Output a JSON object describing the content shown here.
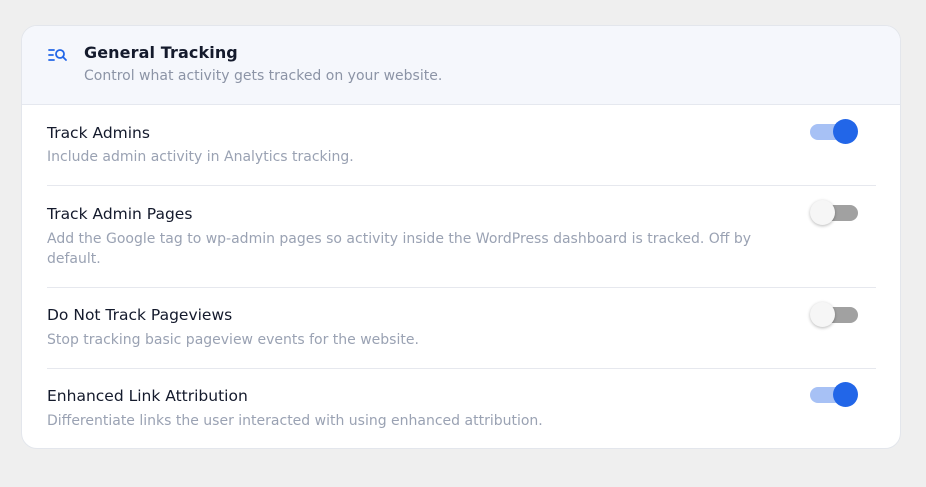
{
  "header": {
    "icon": "list-search-icon",
    "title": "General Tracking",
    "description": "Control what activity gets tracked on your website."
  },
  "settings": [
    {
      "title": "Track Admins",
      "description": "Include admin activity in Analytics tracking.",
      "enabled": true
    },
    {
      "title": "Track Admin Pages",
      "description": "Add the Google tag to wp-admin pages so activity inside the WordPress dashboard is tracked. Off by default.",
      "enabled": false
    },
    {
      "title": "Do Not Track Pageviews",
      "description": "Stop tracking basic pageview events for the website.",
      "enabled": false
    },
    {
      "title": "Enhanced Link Attribution",
      "description": "Differentiate links the user interacted with using enhanced attribution.",
      "enabled": true
    }
  ],
  "colors": {
    "accent": "#2266e8",
    "toggle_on_track": "#a7c1f5",
    "toggle_off_track": "#a1a1a1"
  }
}
